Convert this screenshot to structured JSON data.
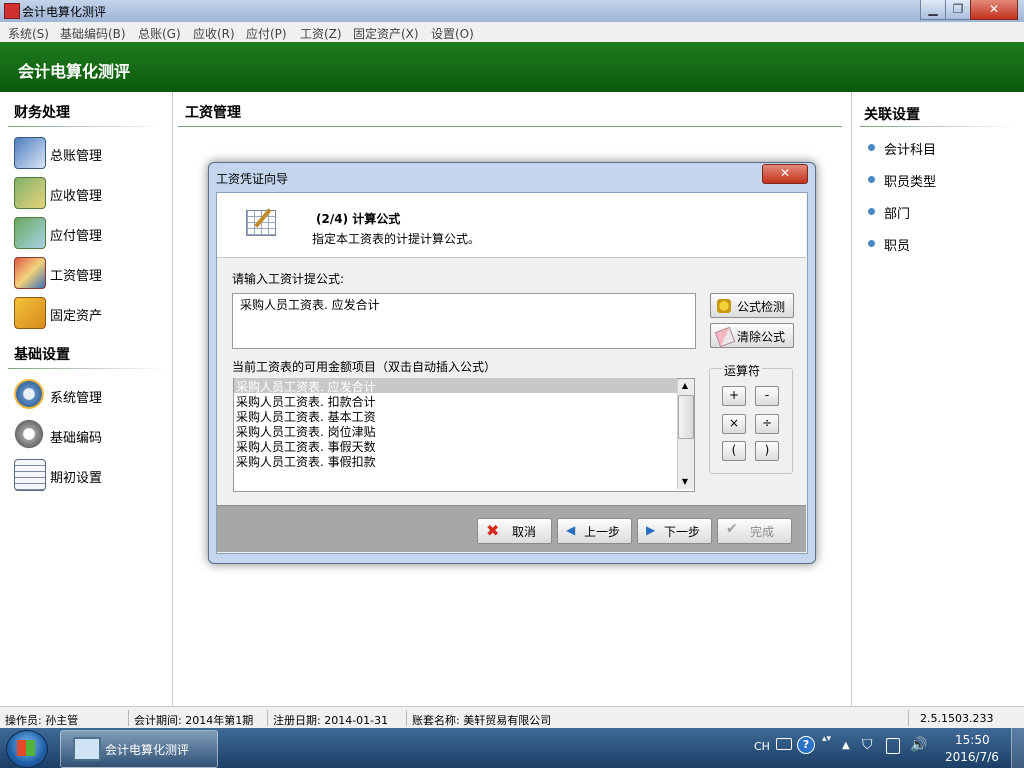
{
  "window": {
    "title": "会计电算化测评",
    "min": "▁",
    "max": "❐",
    "close": "✕"
  },
  "menu": [
    "系统(S)",
    "基础编码(B)",
    "总账(G)",
    "应收(R)",
    "应付(P)",
    "工资(Z)",
    "固定资产(X)",
    "设置(O)"
  ],
  "banner": {
    "title": "会计电算化测评"
  },
  "left": {
    "section1": "财务处理",
    "items1": [
      "总账管理",
      "应收管理",
      "应付管理",
      "工资管理",
      "固定资产"
    ],
    "section2": "基础设置",
    "items2": [
      "系统管理",
      "基础编码",
      "期初设置"
    ]
  },
  "middle": {
    "title": "工资管理"
  },
  "right": {
    "title": "关联设置",
    "items": [
      "会计科目",
      "职员类型",
      "部门",
      "职员"
    ]
  },
  "dialog": {
    "title": "工资凭证向导",
    "close": "✕",
    "step": "(2/4)  计算公式",
    "desc": "指定本工资表的计提计算公式。",
    "formula_label": "请输入工资计提公式:",
    "formula_value": "采购人员工资表. 应发合计",
    "check_btn": "公式检测",
    "clear_btn": "清除公式",
    "items_label": "当前工资表的可用金额项目（双击自动插入公式）",
    "items": [
      "采购人员工资表. 应发合计",
      "采购人员工资表. 扣款合计",
      "采购人员工资表. 基本工资",
      "采购人员工资表. 岗位津贴",
      "采购人员工资表. 事假天数",
      "采购人员工资表. 事假扣款"
    ],
    "ops_title": "运算符",
    "ops": [
      "+",
      "-",
      "×",
      "÷",
      "(",
      ")"
    ],
    "cancel": "取消",
    "prev": "上一步",
    "next": "下一步",
    "finish": "完成"
  },
  "status": {
    "operator": "操作员: 孙主管",
    "period": "会计期间: 2014年第1期",
    "reg_date": "注册日期: 2014-01-31",
    "account": "账套名称: 美轩贸易有限公司",
    "version": "2.5.1503.233"
  },
  "taskbar": {
    "app": "会计电算化测评",
    "lang": "CH",
    "time": "15:50",
    "date": "2016/7/6"
  }
}
